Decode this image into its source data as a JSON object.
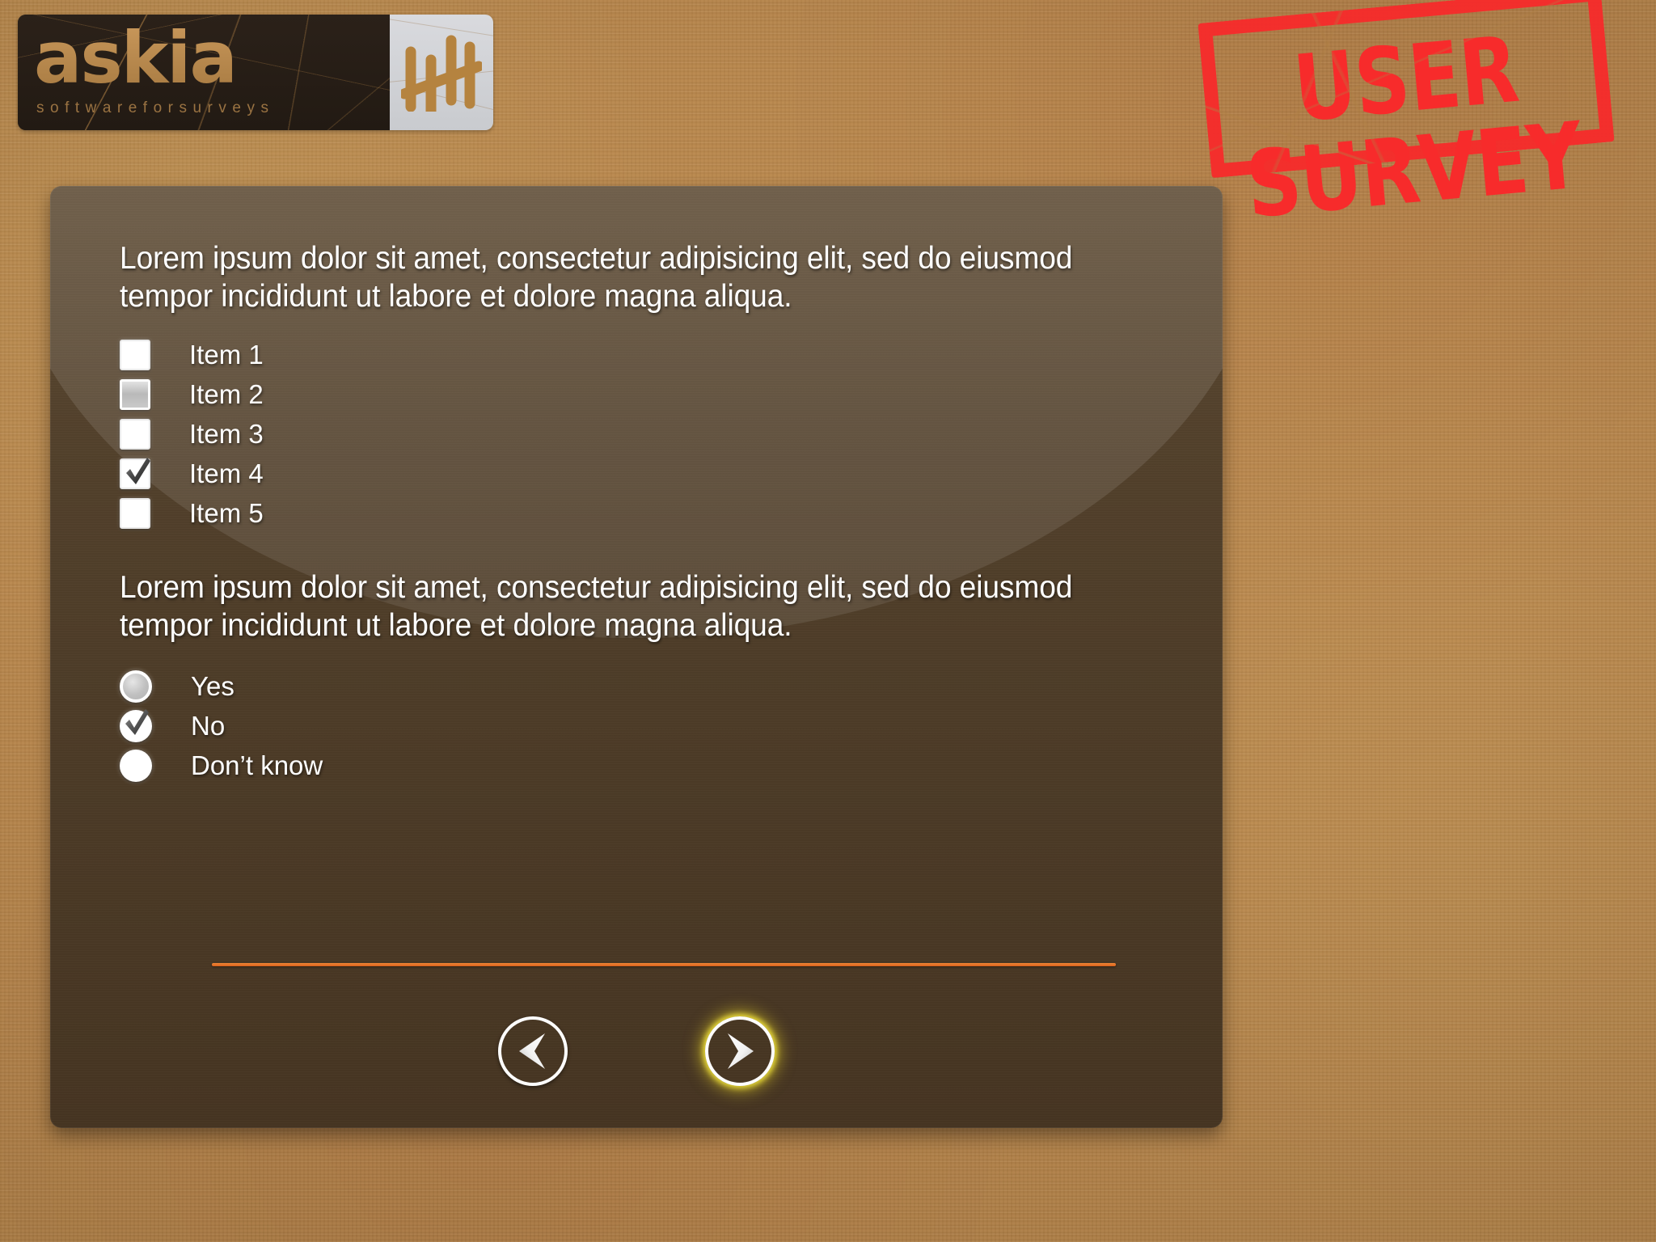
{
  "brand": {
    "name": "askia",
    "tagline": "softwareforsurveys",
    "tally_icon": "tally-marks-icon"
  },
  "stamp": {
    "text": "USER SURVEY",
    "color": "#f72b2b"
  },
  "survey": {
    "question_1": "Lorem ipsum dolor sit amet, consectetur adipisicing elit, sed do eiusmod tempor incididunt ut labore et dolore magna aliqua.",
    "checkbox_options": [
      {
        "label": "Item 1",
        "state": "unchecked"
      },
      {
        "label": "Item 2",
        "state": "hover"
      },
      {
        "label": "Item 3",
        "state": "unchecked"
      },
      {
        "label": "Item 4",
        "state": "checked"
      },
      {
        "label": "Item 5",
        "state": "unchecked"
      }
    ],
    "question_2": "Lorem ipsum dolor sit amet, consectetur adipisicing elit, sed do eiusmod tempor incididunt ut labore et dolore magna aliqua.",
    "radio_options": [
      {
        "label": "Yes",
        "state": "hover"
      },
      {
        "label": "No",
        "state": "checked"
      },
      {
        "label": "Don’t know",
        "state": "unchecked"
      }
    ]
  },
  "nav": {
    "back_icon": "arrow-left-icon",
    "next_icon": "arrow-right-icon",
    "accent_color": "#e8722b",
    "next_glow_color": "#f0e23c"
  }
}
